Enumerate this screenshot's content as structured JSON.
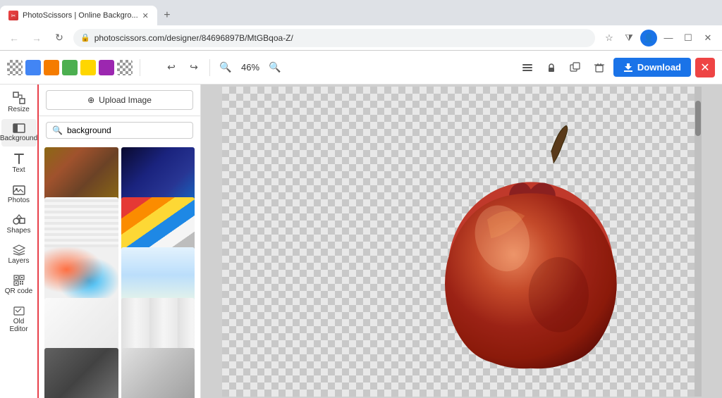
{
  "browser": {
    "tab_title": "PhotoScissors | Online Backgro...",
    "url": "photoscissors.com/designer/84696897B/MtGBqoa-Z/",
    "new_tab_label": "+"
  },
  "toolbar": {
    "colors": [
      {
        "id": "blue",
        "hex": "#4285f4"
      },
      {
        "id": "orange",
        "hex": "#f57c00"
      },
      {
        "id": "green",
        "hex": "#4caf50"
      },
      {
        "id": "yellow",
        "hex": "#ffd600"
      },
      {
        "id": "purple",
        "hex": "#9c27b0"
      }
    ],
    "undo_label": "↩",
    "redo_label": "↪",
    "zoom_level": "46%",
    "download_label": "Download",
    "close_label": "✕",
    "tool_icons": [
      "layers-icon",
      "lock-icon",
      "duplicate-icon",
      "trash-icon"
    ]
  },
  "sidebar": {
    "items": [
      {
        "id": "resize",
        "label": "Resize",
        "icon": "resize-icon"
      },
      {
        "id": "background",
        "label": "Background",
        "icon": "background-icon"
      },
      {
        "id": "text",
        "label": "Text",
        "icon": "text-icon"
      },
      {
        "id": "photos",
        "label": "Photos",
        "icon": "photos-icon"
      },
      {
        "id": "shapes",
        "label": "Shapes",
        "icon": "shapes-icon"
      },
      {
        "id": "layers",
        "label": "Layers",
        "icon": "layers-icon"
      },
      {
        "id": "qrcode",
        "label": "QR code",
        "icon": "qrcode-icon"
      },
      {
        "id": "old-editor",
        "label": "Old Editor",
        "icon": "old-editor-icon"
      }
    ]
  },
  "bg_panel": {
    "upload_label": "Upload Image",
    "search_placeholder": "background",
    "thumbnails": [
      {
        "id": "wood",
        "class": "thumb-wood"
      },
      {
        "id": "dark-blue",
        "class": "thumb-dark-blue"
      },
      {
        "id": "light-stripes",
        "class": "thumb-light-stripes"
      },
      {
        "id": "colorful-stripes",
        "class": "thumb-colorful-stripes"
      },
      {
        "id": "splash",
        "class": "thumb-splash"
      },
      {
        "id": "light-blue",
        "class": "thumb-light-blue"
      },
      {
        "id": "white-light",
        "class": "thumb-white-light"
      },
      {
        "id": "light-texture",
        "class": "thumb-light-texture"
      },
      {
        "id": "gray-dark",
        "class": "thumb-gray-dark"
      },
      {
        "id": "gray-light",
        "class": "thumb-gray-light"
      }
    ]
  },
  "canvas": {
    "zoom": "46%"
  }
}
